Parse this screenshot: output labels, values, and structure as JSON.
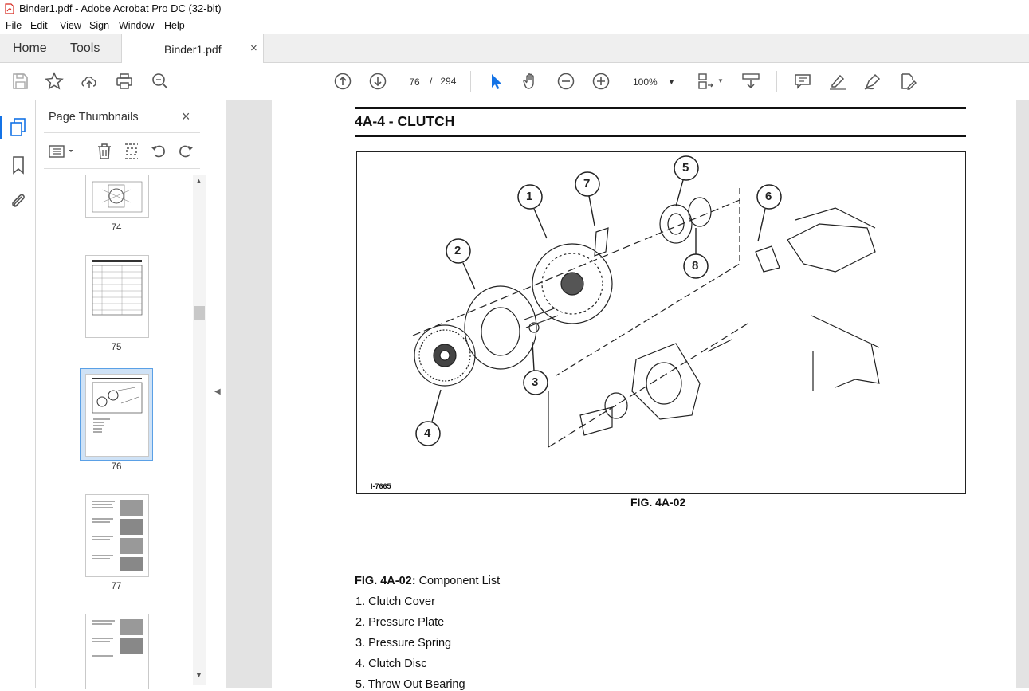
{
  "window": {
    "title": "Binder1.pdf - Adobe Acrobat Pro DC (32-bit)"
  },
  "menu": [
    "File",
    "Edit",
    "View",
    "Sign",
    "Window",
    "Help"
  ],
  "tabs": {
    "home": "Home",
    "tools": "Tools",
    "document": "Binder1.pdf",
    "close": "×"
  },
  "toolbar": {
    "current_page": "76",
    "page_separator": "/",
    "total_pages": "294",
    "zoom": "100%"
  },
  "panel": {
    "title": "Page Thumbnails",
    "close": "×",
    "thumbnails": [
      {
        "label": "74"
      },
      {
        "label": "75"
      },
      {
        "label": "76",
        "selected": true
      },
      {
        "label": "77"
      },
      {
        "label": ""
      }
    ]
  },
  "document": {
    "heading": "4A-4 - CLUTCH",
    "figure": {
      "code": "I-7665",
      "caption": "FIG. 4A-02",
      "callouts": [
        "1",
        "2",
        "3",
        "4",
        "5",
        "6",
        "7",
        "8"
      ]
    },
    "component_list": {
      "heading_bold": "FIG. 4A-02:",
      "heading_rest": " Component List",
      "items": [
        "1. Clutch Cover",
        "2. Pressure Plate",
        "3. Pressure Spring",
        "4. Clutch Disc",
        "5. Throw Out Bearing"
      ]
    }
  },
  "colors": {
    "accent": "#1473e6",
    "pdf_red": "#d7281e",
    "selected_thumb": "#5aa0e6"
  }
}
